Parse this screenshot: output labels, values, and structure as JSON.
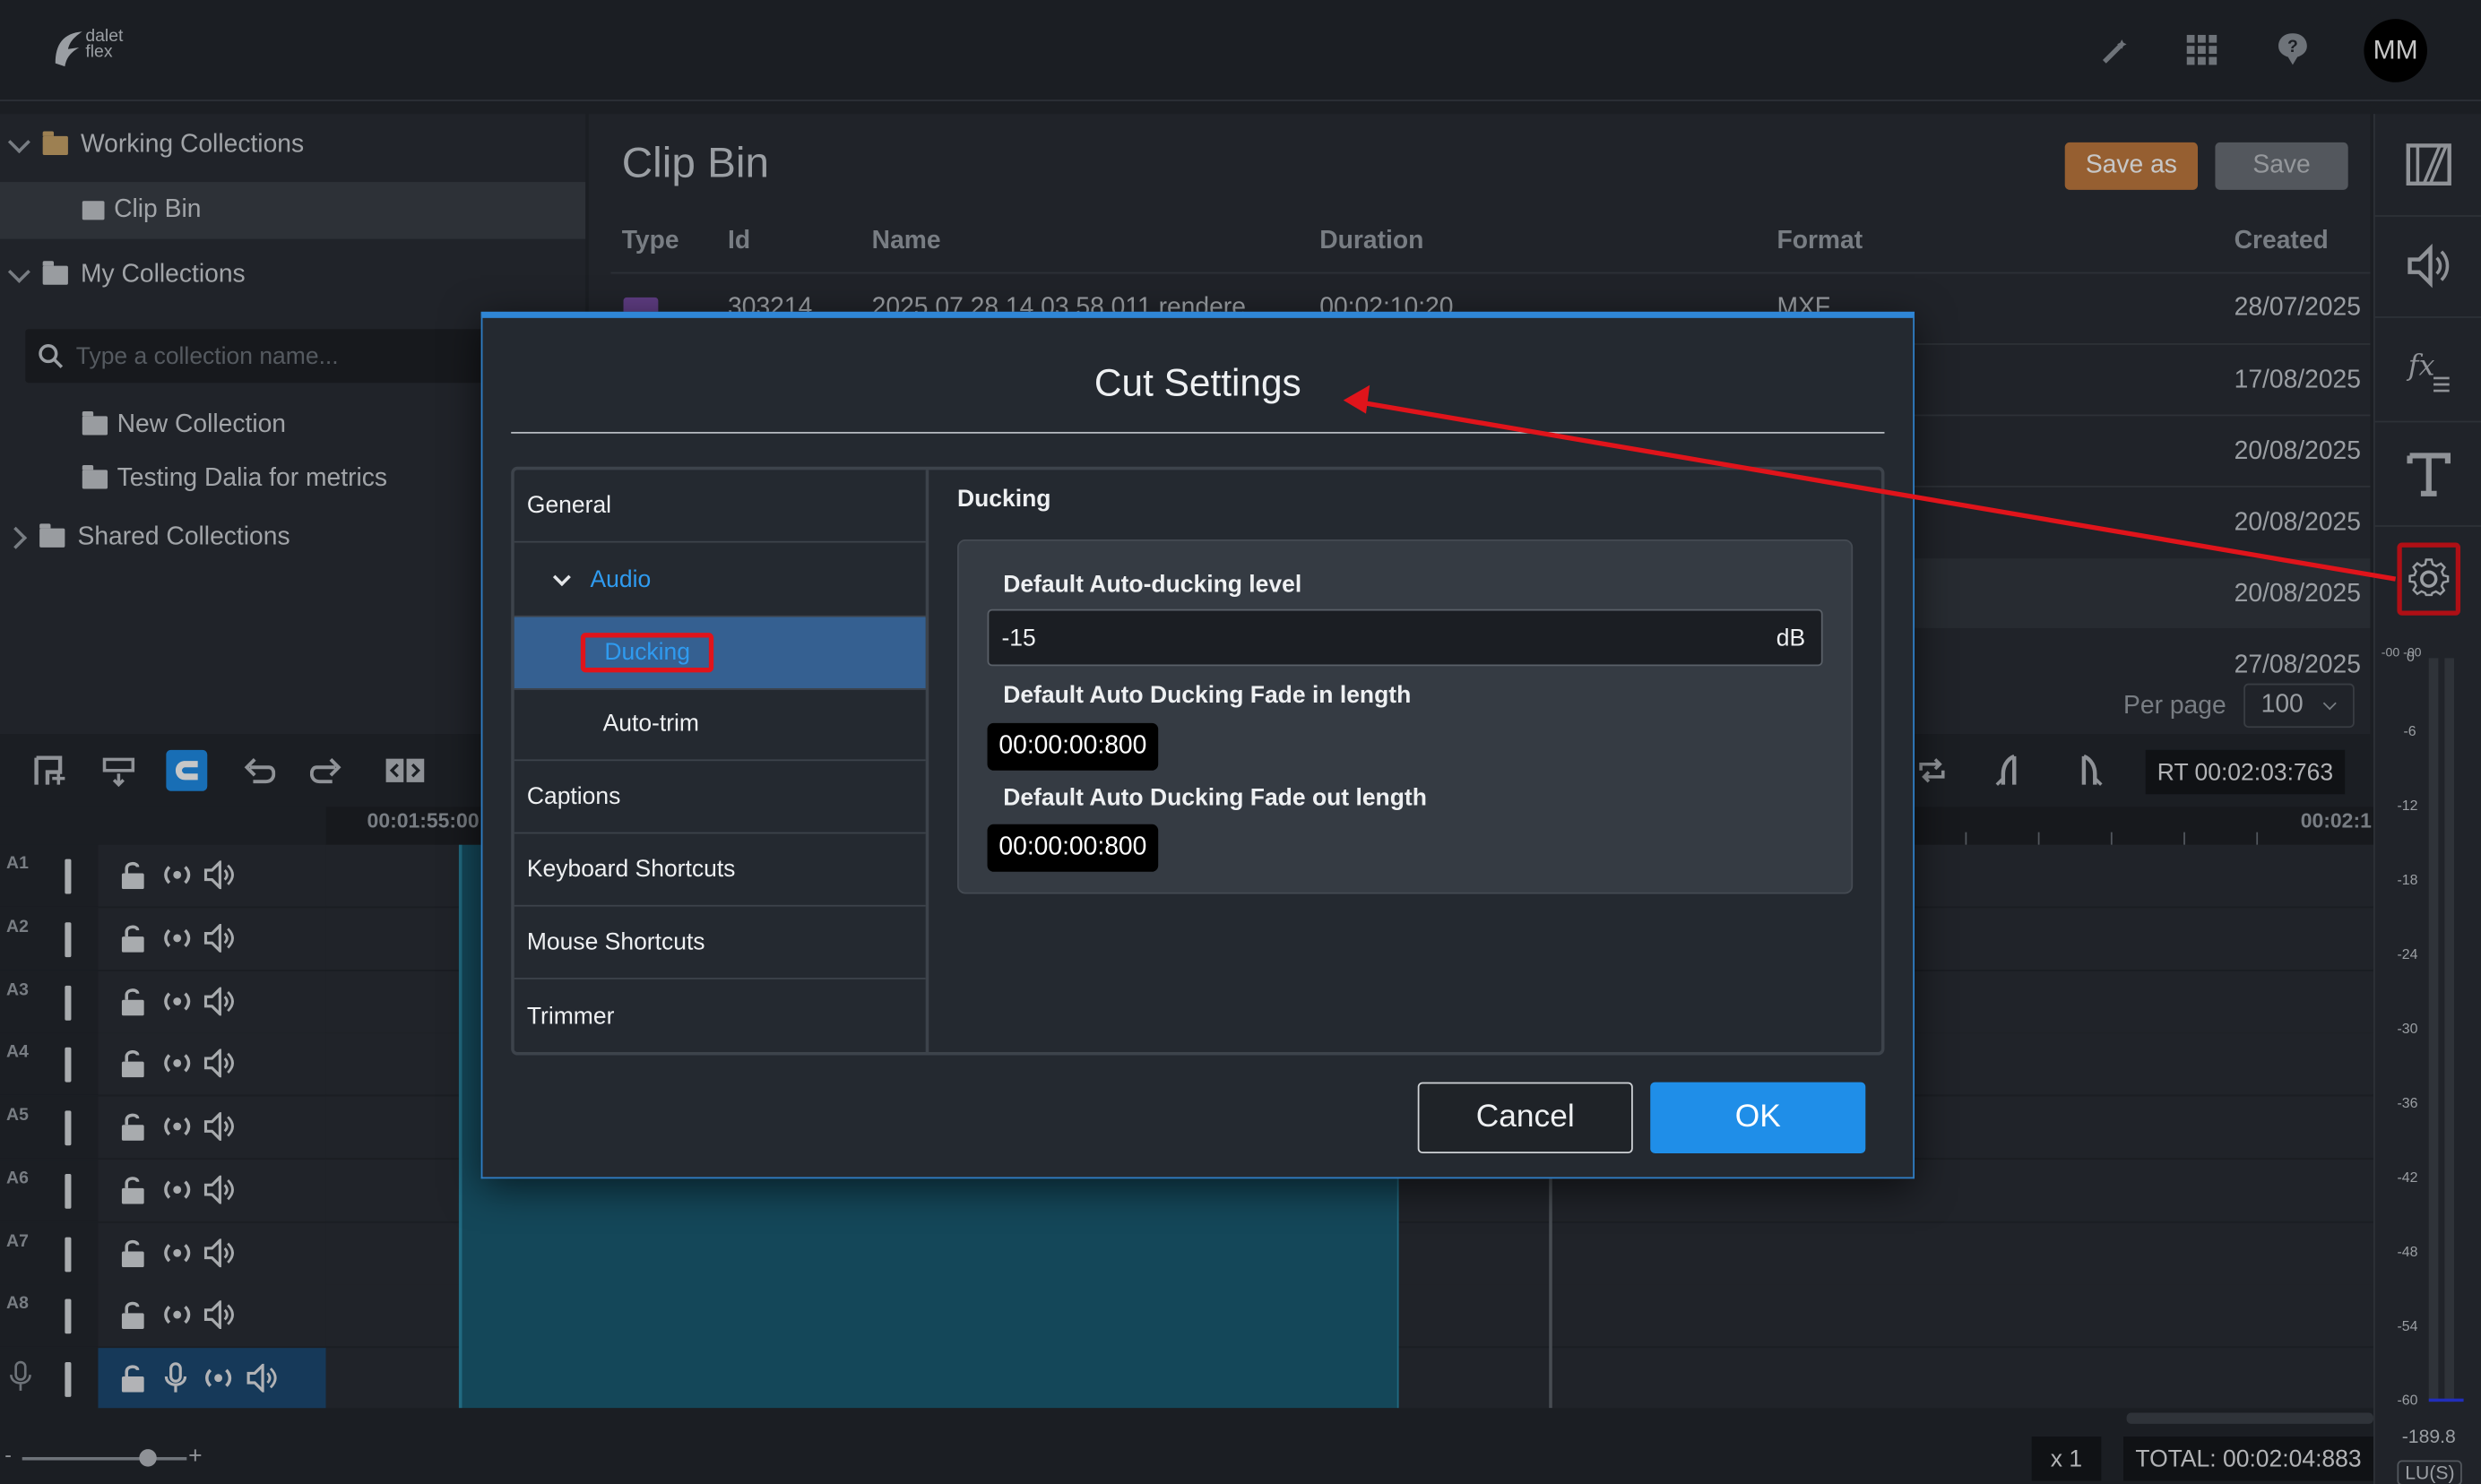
{
  "app": {
    "logo_line1": "dalet",
    "logo_line2": "flex",
    "avatar": "MM"
  },
  "top_icons": [
    "wand-icon",
    "apps-grid-icon",
    "help-icon"
  ],
  "tree": {
    "working_collections": "Working Collections",
    "clip_bin": "Clip Bin",
    "my_collections": "My Collections",
    "search_placeholder": "Type a collection name...",
    "new_collection": "New Collection",
    "testing": "Testing Dalia for metrics",
    "shared_collections": "Shared Collections"
  },
  "clipbin": {
    "title": "Clip Bin",
    "save_as": "Save as",
    "save": "Save",
    "columns": {
      "type": "Type",
      "id": "Id",
      "name": "Name",
      "duration": "Duration",
      "format": "Format",
      "created": "Created"
    },
    "first_row": {
      "id": "303214",
      "name": "2025 07 28 14 03 58 011 rendere",
      "duration": "00:02:10:20",
      "format": "MXF"
    },
    "created": [
      "28/07/2025",
      "17/08/2025",
      "20/08/2025",
      "20/08/2025",
      "20/08/2025",
      "27/08/2025"
    ],
    "per_page_label": "Per page",
    "per_page_value": "100"
  },
  "timeline": {
    "rt": "RT 00:02:03:763",
    "ruler_start": "00:01:55:00",
    "ruler_end": "00:02:1",
    "tracks": [
      "A1",
      "A2",
      "A3",
      "A4",
      "A5",
      "A6",
      "A7",
      "A8"
    ],
    "zoom_minus": "-",
    "zoom_plus": "+",
    "speed": "x 1",
    "total": "TOTAL: 00:02:04:883"
  },
  "meter": {
    "top_label": "-00 -00",
    "scale": [
      "0",
      "-6",
      "-12",
      "-18",
      "-24",
      "-30",
      "-36",
      "-42",
      "-48",
      "-54",
      "-60"
    ],
    "value": "-189.8",
    "unit": "LU(S)"
  },
  "dialog": {
    "title": "Cut Settings",
    "nav": {
      "general": "General",
      "audio": "Audio",
      "ducking": "Ducking",
      "auto_trim": "Auto-trim",
      "captions": "Captions",
      "keyboard": "Keyboard Shortcuts",
      "mouse": "Mouse Shortcuts",
      "trimmer": "Trimmer"
    },
    "section": "Ducking",
    "level_label": "Default Auto-ducking level",
    "level_value": "-15",
    "level_unit": "dB",
    "fade_in_label": "Default Auto Ducking Fade in length",
    "fade_in_value": "00:00:00:800",
    "fade_out_label": "Default Auto Ducking Fade out length",
    "fade_out_value": "00:00:00:800",
    "cancel": "Cancel",
    "ok": "OK"
  },
  "colors": {
    "accent": "#1f8ee8",
    "save_as": "#c17a3f",
    "annotation": "#e0141b",
    "selected_nav": "#356091",
    "clip": "#1a5c72"
  }
}
